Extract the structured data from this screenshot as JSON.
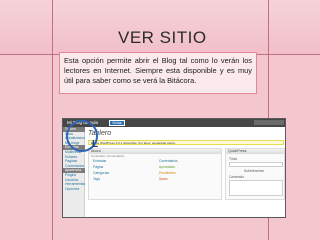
{
  "slide": {
    "title": "VER SITIO",
    "description": "Esta opción permite abrir el Blog tal como lo verán los lectores en Internet. Siempre esta disponible y es muy útil para saber como se verá la Bitácora."
  },
  "colors": {
    "background": "#f4c7cf",
    "frame": "#c1707f",
    "callout_border": "#e28999",
    "circle": "#2f67b4"
  },
  "annotation": {
    "letter": "L"
  },
  "screenshot": {
    "blog_name": "Mi Blog de aula",
    "visit_button": "Visitar",
    "page_title": "Tablero",
    "update_notice": "Existe WordPress 3.0.1 disponible. Por favor, actualízalo ahora.",
    "sidebar_items": [
      "Tablero",
      "Inicio",
      "Actualizaciones",
      "Mis blogs",
      "Entradas",
      "Multimedia",
      "Enlaces",
      "Páginas",
      "Comentarios",
      "Apariencia",
      "Plugins",
      "Usuarios",
      "Herramientas",
      "Opciones"
    ],
    "box_left": {
      "title": "Ahora",
      "sub": "Contenido / Comentarios",
      "rows": [
        [
          "Entradas",
          "Comentarios"
        ],
        [
          "Página",
          "Aprobados"
        ],
        [
          "Categorías",
          "Pendientes"
        ],
        [
          "Tags",
          "Spam"
        ]
      ]
    },
    "box_right": {
      "title": "QuickPress",
      "title_label": "Título",
      "upload_label": "Subir/Insertar",
      "content_label": "Contenido"
    }
  }
}
